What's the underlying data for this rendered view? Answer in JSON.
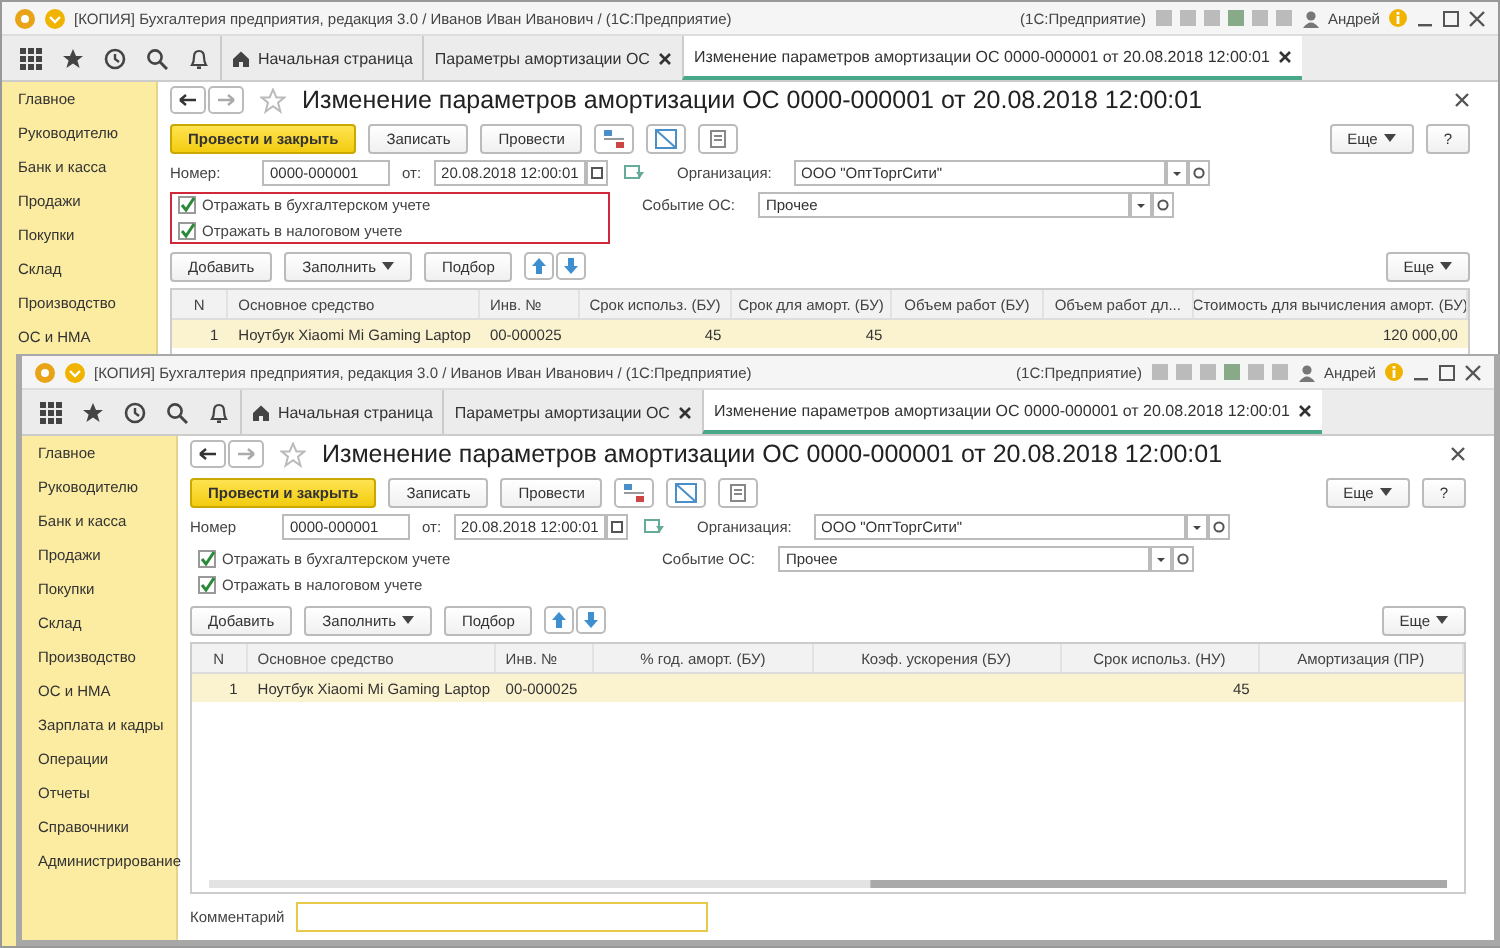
{
  "windows": [
    {
      "title_bar": {
        "title": "[КОПИЯ] Бухгалтерия предприятия, редакция 3.0 / Иванов Иван Иванович / (1С:Предприятие)",
        "app": "(1С:Предприятие)",
        "user": "Андрей"
      },
      "tabs": [
        {
          "label": "Начальная страница",
          "kind": "home",
          "selected": false
        },
        {
          "label": "Параметры амортизации ОС",
          "kind": "closable",
          "selected": false
        },
        {
          "label": "Изменение параметров амортизации ОС 0000-000001 от 20.08.2018 12:00:01",
          "kind": "closable",
          "selected": true
        }
      ],
      "sidebar": {
        "items": [
          "Главное",
          "Руководителю",
          "Банк и касса",
          "Продажи",
          "Покупки",
          "Склад",
          "Производство",
          "ОС и НМА"
        ]
      },
      "document": {
        "title": "Изменение параметров амортизации ОС 0000-000001 от 20.08.2018 12:00:01",
        "buttons": [
          {
            "label": "Провести и закрыть",
            "kind": "primary"
          },
          {
            "label": "Записать",
            "kind": "normal"
          },
          {
            "label": "Провести",
            "kind": "normal"
          }
        ],
        "more": "Еще",
        "help": "?",
        "number_label": "Номер:",
        "number": "0000-000001",
        "date_label": "от:",
        "date": "20.08.2018 12:00:01",
        "organization_label": "Организация:",
        "organization": "ООО \"ОптТоргСити\"",
        "event_label": "Событие ОС:",
        "event": "Прочее",
        "checkboxes_highlighted": true,
        "checkboxes": [
          {
            "label": "Отражать в бухгалтерском учете",
            "checked": true
          },
          {
            "label": "Отражать в налоговом учете",
            "checked": true
          }
        ],
        "table_buttons": [
          {
            "label": "Добавить",
            "kind": "normal"
          },
          {
            "label": "Заполнить",
            "kind": "menu"
          },
          {
            "label": "Подбор",
            "kind": "normal"
          }
        ],
        "table_more": "Еще",
        "table": {
          "columns": [
            {
              "label": "N",
              "kind": "number"
            },
            {
              "label": "Основное средство",
              "kind": "text"
            },
            {
              "label": "Инв. №",
              "kind": "text"
            },
            {
              "label": "Срок использ. (БУ)",
              "kind": "number"
            },
            {
              "label": "Срок для аморт. (БУ)",
              "kind": "number"
            },
            {
              "label": "Объем работ (БУ)",
              "kind": "number"
            },
            {
              "label": "Объем работ дл...",
              "kind": "number"
            },
            {
              "label": "Стоимость для вычисления аморт. (БУ)",
              "kind": "number"
            }
          ],
          "rows": [
            {
              "selected": true,
              "cells": [
                "1",
                "Ноутбук Xiaomi Mi Gaming Laptop",
                "00-000025",
                "45",
                "45",
                null,
                null,
                "120 000,00"
              ]
            }
          ]
        }
      }
    },
    {
      "title_bar": {
        "title": "[КОПИЯ] Бухгалтерия предприятия, редакция 3.0 / Иванов Иван Иванович / (1С:Предприятие)",
        "app": "(1С:Предприятие)",
        "user": "Андрей"
      },
      "tabs": [
        {
          "label": "Начальная страница",
          "kind": "home",
          "selected": false
        },
        {
          "label": "Параметры амортизации ОС",
          "kind": "closable",
          "selected": false
        },
        {
          "label": "Изменение параметров амортизации ОС 0000-000001 от 20.08.2018 12:00:01",
          "kind": "closable",
          "selected": true
        }
      ],
      "sidebar": {
        "items": [
          "Главное",
          "Руководителю",
          "Банк и касса",
          "Продажи",
          "Покупки",
          "Склад",
          "Производство",
          "ОС и НМА",
          "Зарплата и кадры",
          "Операции",
          "Отчеты",
          "Справочники",
          "Администрирование"
        ]
      },
      "document": {
        "title": "Изменение параметров амортизации ОС 0000-000001 от 20.08.2018 12:00:01",
        "buttons": [
          {
            "label": "Провести и закрыть",
            "kind": "primary"
          },
          {
            "label": "Записать",
            "kind": "normal"
          },
          {
            "label": "Провести",
            "kind": "normal"
          }
        ],
        "more": "Еще",
        "help": "?",
        "number_label": "Номер",
        "number": "0000-000001",
        "date_label": "от:",
        "date": "20.08.2018 12:00:01",
        "organization_label": "Организация:",
        "organization": "ООО \"ОптТоргСити\"",
        "event_label": "Событие ОС:",
        "event": "Прочее",
        "checkboxes_highlighted": false,
        "checkboxes": [
          {
            "label": "Отражать в бухгалтерском учете",
            "checked": true
          },
          {
            "label": "Отражать в налоговом учете",
            "checked": true
          }
        ],
        "table_buttons": [
          {
            "label": "Добавить",
            "kind": "normal"
          },
          {
            "label": "Заполнить",
            "kind": "menu"
          },
          {
            "label": "Подбор",
            "kind": "normal"
          }
        ],
        "table_more": "Еще",
        "table": {
          "columns": [
            {
              "label": "N",
              "kind": "number"
            },
            {
              "label": "Основное средство",
              "kind": "text"
            },
            {
              "label": "Инв. №",
              "kind": "text"
            },
            {
              "label": "% год. аморт. (БУ)",
              "kind": "number"
            },
            {
              "label": "Коэф. ускорения (БУ)",
              "kind": "number"
            },
            {
              "label": "Срок использ. (НУ)",
              "kind": "number"
            },
            {
              "label": "Амортизация (ПР)",
              "kind": "number"
            }
          ],
          "rows": [
            {
              "selected": true,
              "cells": [
                "1",
                "Ноутбук Xiaomi Mi Gaming Laptop",
                "00-000025",
                null,
                null,
                "45",
                null
              ]
            }
          ]
        },
        "comment": {
          "label": "Комментарий"
        }
      }
    }
  ]
}
